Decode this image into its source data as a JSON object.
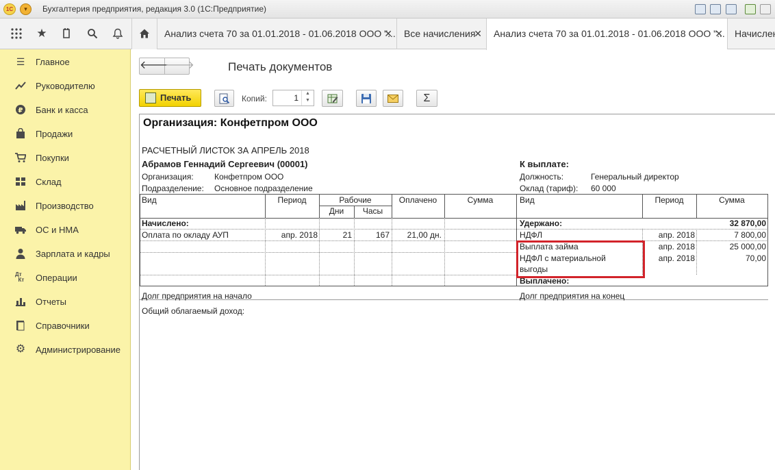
{
  "titlebar": {
    "logo": "1С",
    "title": "Бухгалтерия предприятия, редакция 3.0  (1С:Предприятие)"
  },
  "tabs": [
    {
      "label": "Анализ счета 70 за 01.01.2018 - 01.06.2018 ООО \"..."
    },
    {
      "label": "Все начисления"
    },
    {
      "label": "Анализ счета 70 за 01.01.2018 - 01.06.2018 ООО \"..."
    },
    {
      "label": "Начислени"
    }
  ],
  "tab_close": "✕",
  "sidebar": {
    "items": [
      {
        "label": "Главное",
        "icon": "menu-icon"
      },
      {
        "label": "Руководителю",
        "icon": "trend-icon"
      },
      {
        "label": "Банк и касса",
        "icon": "ruble-icon"
      },
      {
        "label": "Продажи",
        "icon": "bag-icon"
      },
      {
        "label": "Покупки",
        "icon": "cart-icon"
      },
      {
        "label": "Склад",
        "icon": "warehouse-icon"
      },
      {
        "label": "Производство",
        "icon": "factory-icon"
      },
      {
        "label": "ОС и НМА",
        "icon": "truck-icon"
      },
      {
        "label": "Зарплата и кадры",
        "icon": "person-icon"
      },
      {
        "label": "Операции",
        "icon": "dt-kt-icon"
      },
      {
        "label": "Отчеты",
        "icon": "bar-chart-icon"
      },
      {
        "label": "Справочники",
        "icon": "book-icon"
      },
      {
        "label": "Администрирование",
        "icon": "gear-icon"
      }
    ]
  },
  "form": {
    "title": "Печать документов",
    "print_label": "Печать",
    "copies_label": "Копий:",
    "copies_value": "1",
    "sum_symbol": "Σ"
  },
  "doc": {
    "org_header": "Организация: Конфетпром ООО",
    "sheet_title": "РАСЧЕТНЫЙ ЛИСТОК ЗА АПРЕЛЬ 2018",
    "employee": "Абрамов Геннадий Сергеевич (00001)",
    "org_label": "Организация:",
    "org_value": "Конфетпром ООО",
    "dept_label": "Подразделение:",
    "dept_value": "Основное подразделение",
    "to_pay_label": "К выплате:",
    "position_label": "Должность:",
    "position_value": "Генеральный директор",
    "salary_label": "Оклад (тариф):",
    "salary_value": "60 000",
    "left_headers": {
      "vid": "Вид",
      "period": "Период",
      "working": "Рабочие",
      "days": "Дни",
      "hours": "Часы",
      "paid": "Оплачено",
      "sum": "Сумма"
    },
    "right_headers": {
      "vid": "Вид",
      "period": "Период",
      "sum": "Сумма"
    },
    "accrued_label": "Начислено:",
    "accrued_rows": [
      {
        "vid": "Оплата по окладу АУП",
        "period": "апр. 2018",
        "days": "21",
        "hours": "167",
        "paid": "21,00 дн.",
        "sum": ""
      }
    ],
    "withheld_label": "Удержано:",
    "withheld_total": "32 870,00",
    "withheld_rows": [
      {
        "vid": "НДФЛ",
        "period": "апр. 2018",
        "sum": "7 800,00"
      },
      {
        "vid": "Выплата займа",
        "period": "апр. 2018",
        "sum": "25 000,00"
      },
      {
        "vid": "НДФЛ с материальной",
        "vid2": "выгоды",
        "period": "апр. 2018",
        "sum": "70,00"
      }
    ],
    "paid_out_label": "Выплачено:",
    "debt_start_label": "Долг предприятия на начало",
    "debt_end_label": "Долг предприятия на конец",
    "taxable_income_label": "Общий облагаемый доход:"
  },
  "colors": {
    "sidebar_bg": "#fbf3a9",
    "print_button": "#f2d200",
    "highlight_box": "#d2232a"
  }
}
